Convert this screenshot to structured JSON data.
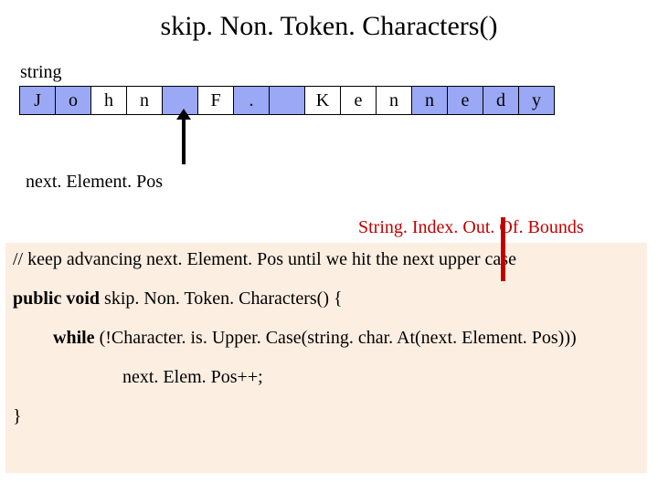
{
  "title": "skip. Non. Token. Characters()",
  "labels": {
    "string": "string",
    "nextElementPos": "next. Element. Pos",
    "exception": "String. Index. Out. Of. Bounds"
  },
  "cells": [
    {
      "ch": "J",
      "blue": true
    },
    {
      "ch": "o",
      "blue": true
    },
    {
      "ch": "h",
      "blue": false
    },
    {
      "ch": "n",
      "blue": false
    },
    {
      "ch": "",
      "blue": true
    },
    {
      "ch": "F",
      "blue": false
    },
    {
      "ch": ".",
      "blue": true
    },
    {
      "ch": "",
      "blue": true
    },
    {
      "ch": "K",
      "blue": false
    },
    {
      "ch": "e",
      "blue": false
    },
    {
      "ch": "n",
      "blue": false
    },
    {
      "ch": "n",
      "blue": true
    },
    {
      "ch": "e",
      "blue": true
    },
    {
      "ch": "d",
      "blue": true
    },
    {
      "ch": "y",
      "blue": true
    }
  ],
  "code": {
    "comment": "// keep advancing next. Element. Pos until we hit the next upper case",
    "sig_kw": "public void ",
    "sig_rest": "skip. Non. Token. Characters() {",
    "while_kw": "while ",
    "while_rest": "(!Character. is. Upper. Case(string. char. At(next. Element. Pos)))",
    "body": "next. Elem. Pos++;",
    "close": "}"
  }
}
